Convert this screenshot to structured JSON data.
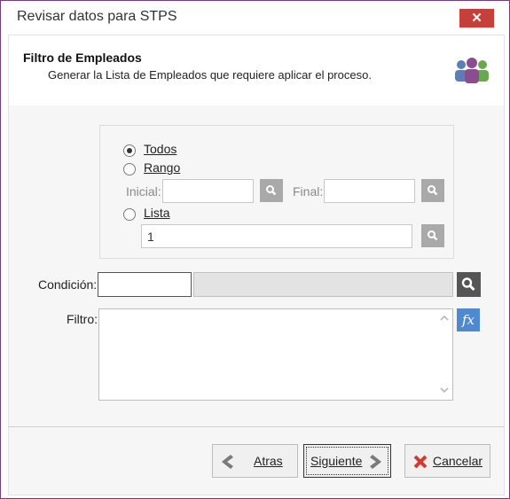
{
  "window": {
    "title": "Revisar datos para STPS",
    "close_glyph": "✕"
  },
  "header": {
    "title": "Filtro de Empleados",
    "subtitle": "Generar la Lista de Empleados que requiere aplicar el proceso.",
    "icon": "users-icon"
  },
  "employees": {
    "todos_label": "Todos",
    "rango_label": "Rango",
    "inicial_label": "Inicial:",
    "inicial_value": "",
    "final_label": "Final:",
    "final_value": "",
    "lista_label": "Lista",
    "lista_value": "1",
    "selected": "Todos"
  },
  "condicion": {
    "label": "Condición:",
    "code_value": "",
    "description_value": ""
  },
  "filtro": {
    "label": "Filtro:",
    "value": "",
    "fx_glyph": "fx"
  },
  "footer": {
    "back_label": "Atras",
    "next_label": "Siguiente",
    "cancel_label": "Cancelar"
  },
  "colors": {
    "accent": "#4f8ad1",
    "close": "#c5403a",
    "cancel_icon": "#d03a32",
    "nav_arrow": "#7a7a7a"
  }
}
